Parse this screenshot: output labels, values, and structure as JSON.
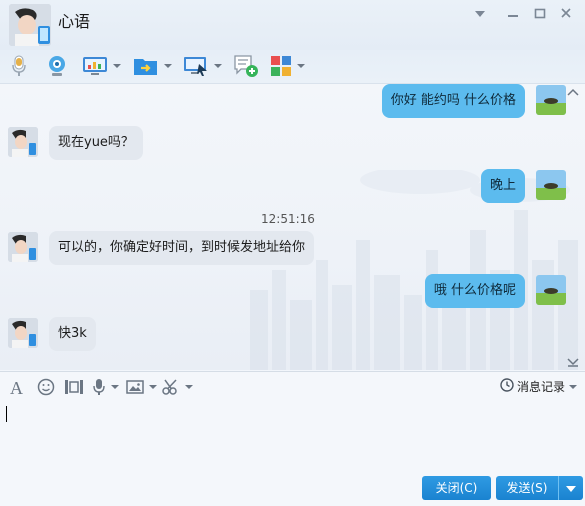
{
  "window": {
    "title": "心语",
    "controls": [
      "chevron-down-icon",
      "minimize-icon",
      "maximize-icon",
      "close-icon"
    ]
  },
  "toolbar": {
    "items": [
      "microphone-icon",
      "webcam-icon",
      "screen-share-icon",
      "folder-send-icon",
      "remote-desktop-icon",
      "add-chat-icon",
      "apps-icon"
    ]
  },
  "messages": [
    {
      "side": "right",
      "text": "你好  能约吗  什么价格"
    },
    {
      "side": "left",
      "text": "现在yue吗？"
    },
    {
      "side": "right",
      "text": "晚上"
    },
    {
      "side": "time",
      "text": "12:51:16"
    },
    {
      "side": "left",
      "text": "可以的，你确定好时间，到时候发地址给你"
    },
    {
      "side": "right",
      "text": "哦 什么价格呢"
    },
    {
      "side": "left",
      "text": "快3k"
    }
  ],
  "input_toolbar": {
    "items": [
      "font-icon",
      "emoji-icon",
      "screenshot-icon",
      "voice-icon",
      "image-icon",
      "scissors-icon"
    ],
    "history_label": "消息记录"
  },
  "input": {
    "value": ""
  },
  "buttons": {
    "close": "关闭(C)",
    "send": "发送(S)"
  },
  "colors": {
    "bubble_right": "#5cbbee",
    "bubble_left": "#e3e8ef",
    "button": "#1a83d0"
  }
}
